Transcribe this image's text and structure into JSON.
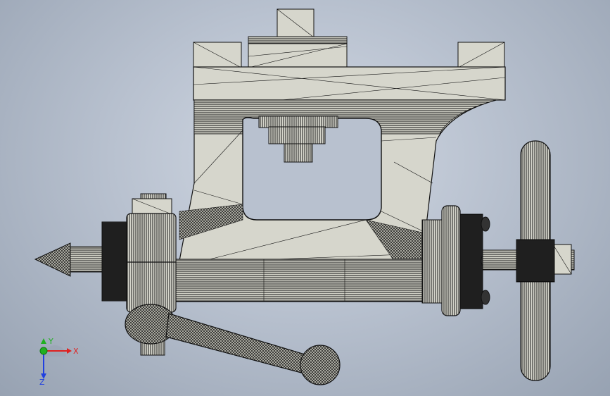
{
  "viewport": {
    "background_top": "#d2d9e4",
    "background_bottom": "#97a2b2",
    "model_face_color": "#d6d6cc",
    "model_edge_color": "#111111",
    "hatch_color": "#1a1a1a"
  },
  "triad": {
    "x_label": "X",
    "y_label": "Y",
    "z_label": "Z",
    "x_color": "#e02020",
    "y_color": "#20b020",
    "z_color": "#2040e0"
  }
}
